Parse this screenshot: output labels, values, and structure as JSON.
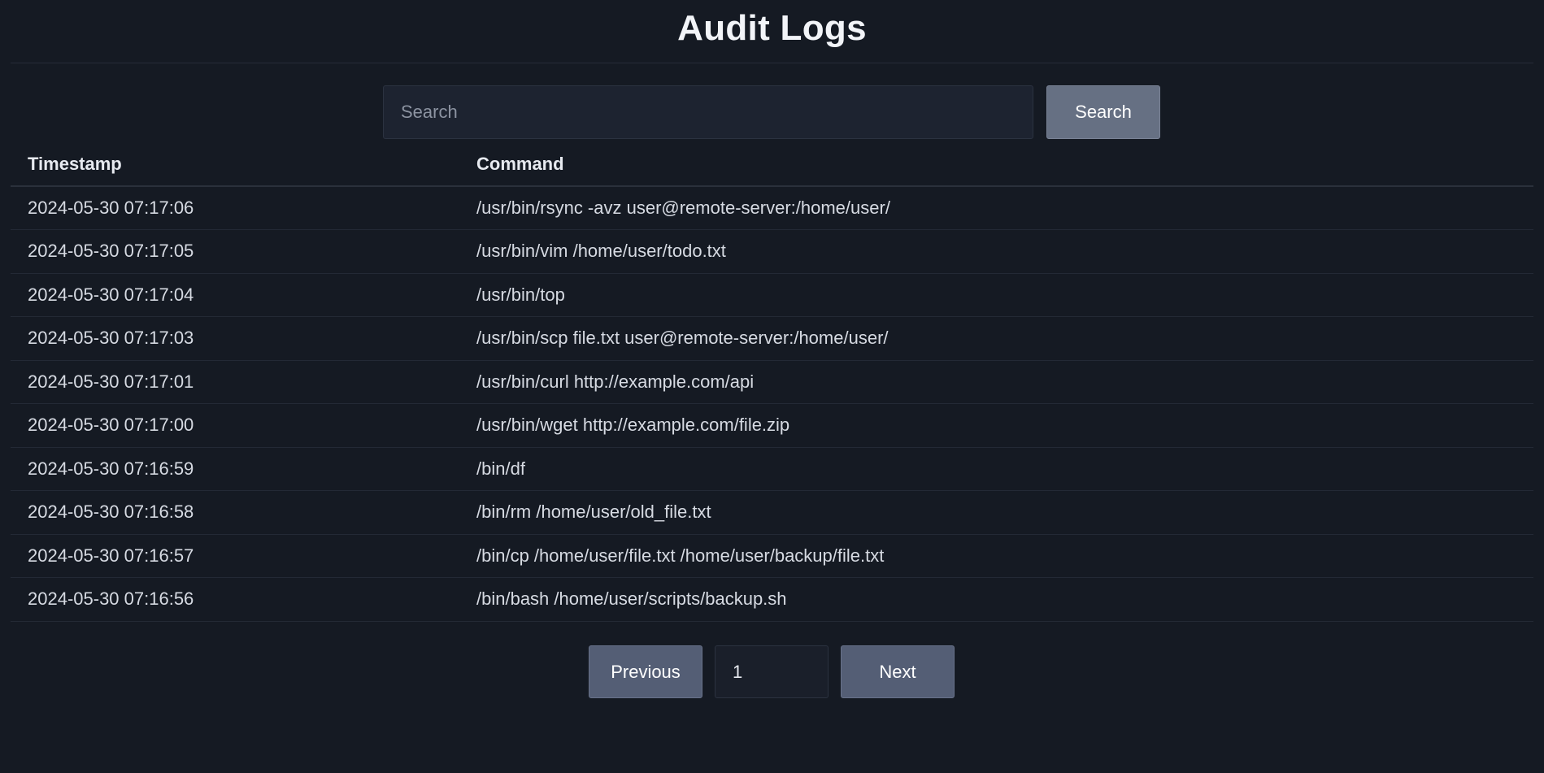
{
  "header": {
    "title": "Audit Logs"
  },
  "search": {
    "placeholder": "Search",
    "value": "",
    "button_label": "Search"
  },
  "table": {
    "columns": [
      "Timestamp",
      "Command"
    ],
    "rows": [
      {
        "timestamp": "2024-05-30 07:17:06",
        "command": "/usr/bin/rsync -avz user@remote-server:/home/user/"
      },
      {
        "timestamp": "2024-05-30 07:17:05",
        "command": "/usr/bin/vim /home/user/todo.txt"
      },
      {
        "timestamp": "2024-05-30 07:17:04",
        "command": "/usr/bin/top"
      },
      {
        "timestamp": "2024-05-30 07:17:03",
        "command": "/usr/bin/scp file.txt user@remote-server:/home/user/"
      },
      {
        "timestamp": "2024-05-30 07:17:01",
        "command": "/usr/bin/curl http://example.com/api"
      },
      {
        "timestamp": "2024-05-30 07:17:00",
        "command": "/usr/bin/wget http://example.com/file.zip"
      },
      {
        "timestamp": "2024-05-30 07:16:59",
        "command": "/bin/df"
      },
      {
        "timestamp": "2024-05-30 07:16:58",
        "command": "/bin/rm /home/user/old_file.txt"
      },
      {
        "timestamp": "2024-05-30 07:16:57",
        "command": "/bin/cp /home/user/file.txt /home/user/backup/file.txt"
      },
      {
        "timestamp": "2024-05-30 07:16:56",
        "command": "/bin/bash /home/user/scripts/backup.sh"
      }
    ]
  },
  "pagination": {
    "previous_label": "Previous",
    "page_value": "1",
    "next_label": "Next"
  },
  "colors": {
    "background": "#151a23",
    "button": "#667083",
    "pager_button": "#545e75"
  }
}
